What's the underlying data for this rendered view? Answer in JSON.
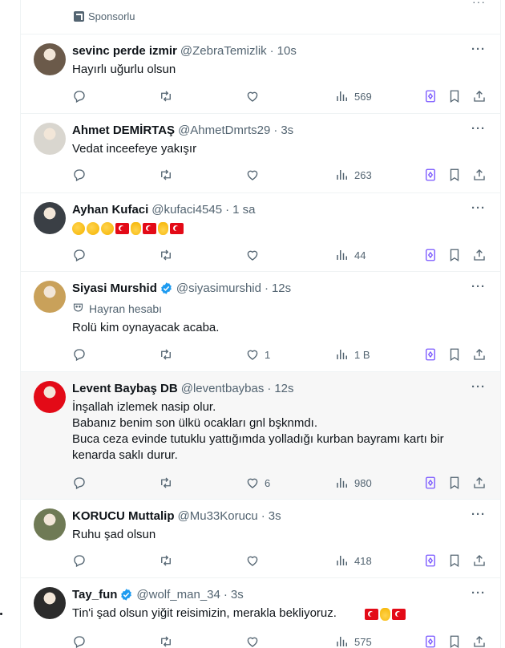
{
  "ad": {
    "label": "Sponsorlu"
  },
  "tweets": [
    {
      "name": "sevinc perde izmir",
      "handle": "@ZebraTemizlik",
      "time": "10s",
      "verified": false,
      "text": "Hayırlı uğurlu olsun",
      "replies": "",
      "retweets": "",
      "likes": "",
      "views": "569",
      "avatar_color": "#6b5a4a"
    },
    {
      "name": "Ahmet DEMİRTAŞ",
      "handle": "@AhmetDmrts29",
      "time": "3s",
      "verified": false,
      "text": "Vedat inceefeye yakışır",
      "replies": "",
      "retweets": "",
      "likes": "",
      "views": "263",
      "avatar_color": "#d9d6cf"
    },
    {
      "name": "Ayhan Kufaci",
      "handle": "@kufaci4545",
      "time": "1 sa",
      "verified": false,
      "emojis": [
        "clap",
        "clap",
        "clap",
        "flag",
        "horns",
        "flag",
        "horns",
        "flag"
      ],
      "replies": "",
      "retweets": "",
      "likes": "",
      "views": "44",
      "avatar_color": "#3a3f45"
    },
    {
      "name": "Siyasi Murshid",
      "handle": "@siyasimurshid",
      "time": "12s",
      "verified": true,
      "fan_label": "Hayran hesabı",
      "text": "Rolü kim oynayacak acaba.",
      "replies": "",
      "retweets": "",
      "likes": "1",
      "views": "1 B",
      "avatar_color": "#c9a15a"
    },
    {
      "name": "Levent Baybaş DB",
      "handle": "@leventbaybas",
      "time": "12s",
      "verified": false,
      "text": "İnşallah izlemek nasip olur.\nBabanız benim son ülkü ocakları gnl bşknmdı.\nBuca ceza evinde tutuklu yattığımda  yolladığı kurban  bayramı kartı bir kenarda saklı durur.",
      "replies": "",
      "retweets": "",
      "likes": "6",
      "views": "980",
      "avatar_color": "#e30a17"
    },
    {
      "name": "KORUCU Muttalip",
      "handle": "@Mu33Korucu",
      "time": "3s",
      "verified": false,
      "text": "Ruhu şad olsun",
      "replies": "",
      "retweets": "",
      "likes": "",
      "views": "418",
      "avatar_color": "#6f7a55"
    },
    {
      "name": "Tay_fun",
      "handle": "@wolf_man_34",
      "time": "3s",
      "verified": true,
      "text": "Tin'i şad olsun yiğit reisimizin, merakla bekliyoruz.",
      "emojis": [
        "flag",
        "horns",
        "flag"
      ],
      "replies": "",
      "retweets": "",
      "likes": "",
      "views": "575",
      "avatar_color": "#2b2b2b"
    }
  ],
  "colors": {
    "text": "#0f1419",
    "secondary": "#536471",
    "verified": "#1d9bf0",
    "grok": "#7856ff",
    "border": "#eff3f4",
    "highlight_bg": "#f7f7f7"
  },
  "icons": {
    "reply": "reply-icon",
    "retweet": "retweet-icon",
    "like": "heart-icon",
    "views": "views-icon",
    "grok": "grok-icon",
    "bookmark": "bookmark-icon",
    "share": "share-icon",
    "more": "more-icon"
  }
}
